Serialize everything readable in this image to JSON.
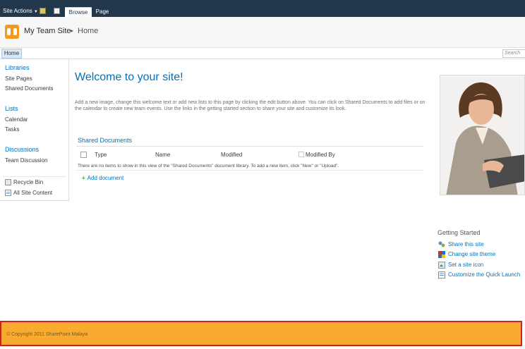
{
  "ribbon": {
    "site_actions_label": "Site Actions",
    "tabs": [
      {
        "label": "Browse"
      },
      {
        "label": "Page"
      }
    ]
  },
  "header": {
    "site_title": "My Team Site",
    "breadcrumb_separator": "▸",
    "current_page": "Home"
  },
  "topnav": {
    "home_tab": "Home",
    "search_placeholder": "Search"
  },
  "quick_launch": {
    "sections": [
      {
        "heading": "Libraries",
        "items": [
          "Site Pages",
          "Shared Documents"
        ]
      },
      {
        "heading": "Lists",
        "items": [
          "Calendar",
          "Tasks"
        ]
      },
      {
        "heading": "Discussions",
        "items": [
          "Team Discussion"
        ]
      }
    ],
    "footer_items": [
      "Recycle Bin",
      "All Site Content"
    ]
  },
  "main": {
    "welcome_title": "Welcome to your site!",
    "intro_text": "Add a new image, change this welcome text or add new lists to this page by clicking the edit button above. You can click on Shared Documents to add files or on the calendar to create new team events. Use the links in the getting started section to share your site and customize its look."
  },
  "shared_documents": {
    "title": "Shared Documents",
    "columns": [
      "Type",
      "Name",
      "Modified",
      "Modified By"
    ],
    "empty_message": "There are no items to show in this view of the \"Shared Documents\" document library. To add a new item, click \"New\" or \"Upload\".",
    "add_label": "Add document"
  },
  "getting_started": {
    "title": "Getting Started",
    "links": [
      "Share this site",
      "Change site theme",
      "Set a site icon",
      "Customize the Quick Launch"
    ]
  },
  "footer": {
    "copyright": "© Copyright 2011 SharePoint Malaya"
  },
  "colors": {
    "ribbon": "#21374c",
    "link": "#0072bc",
    "footer": "#f9ab2f",
    "footer_border": "#d21f2b"
  },
  "icons": [
    "caret-down-icon",
    "upload-icon",
    "edit-icon",
    "site-logo-icon",
    "recycle-bin-icon",
    "all-content-icon",
    "add-icon",
    "share-icon",
    "theme-icon",
    "site-icon-icon",
    "quick-launch-icon"
  ]
}
